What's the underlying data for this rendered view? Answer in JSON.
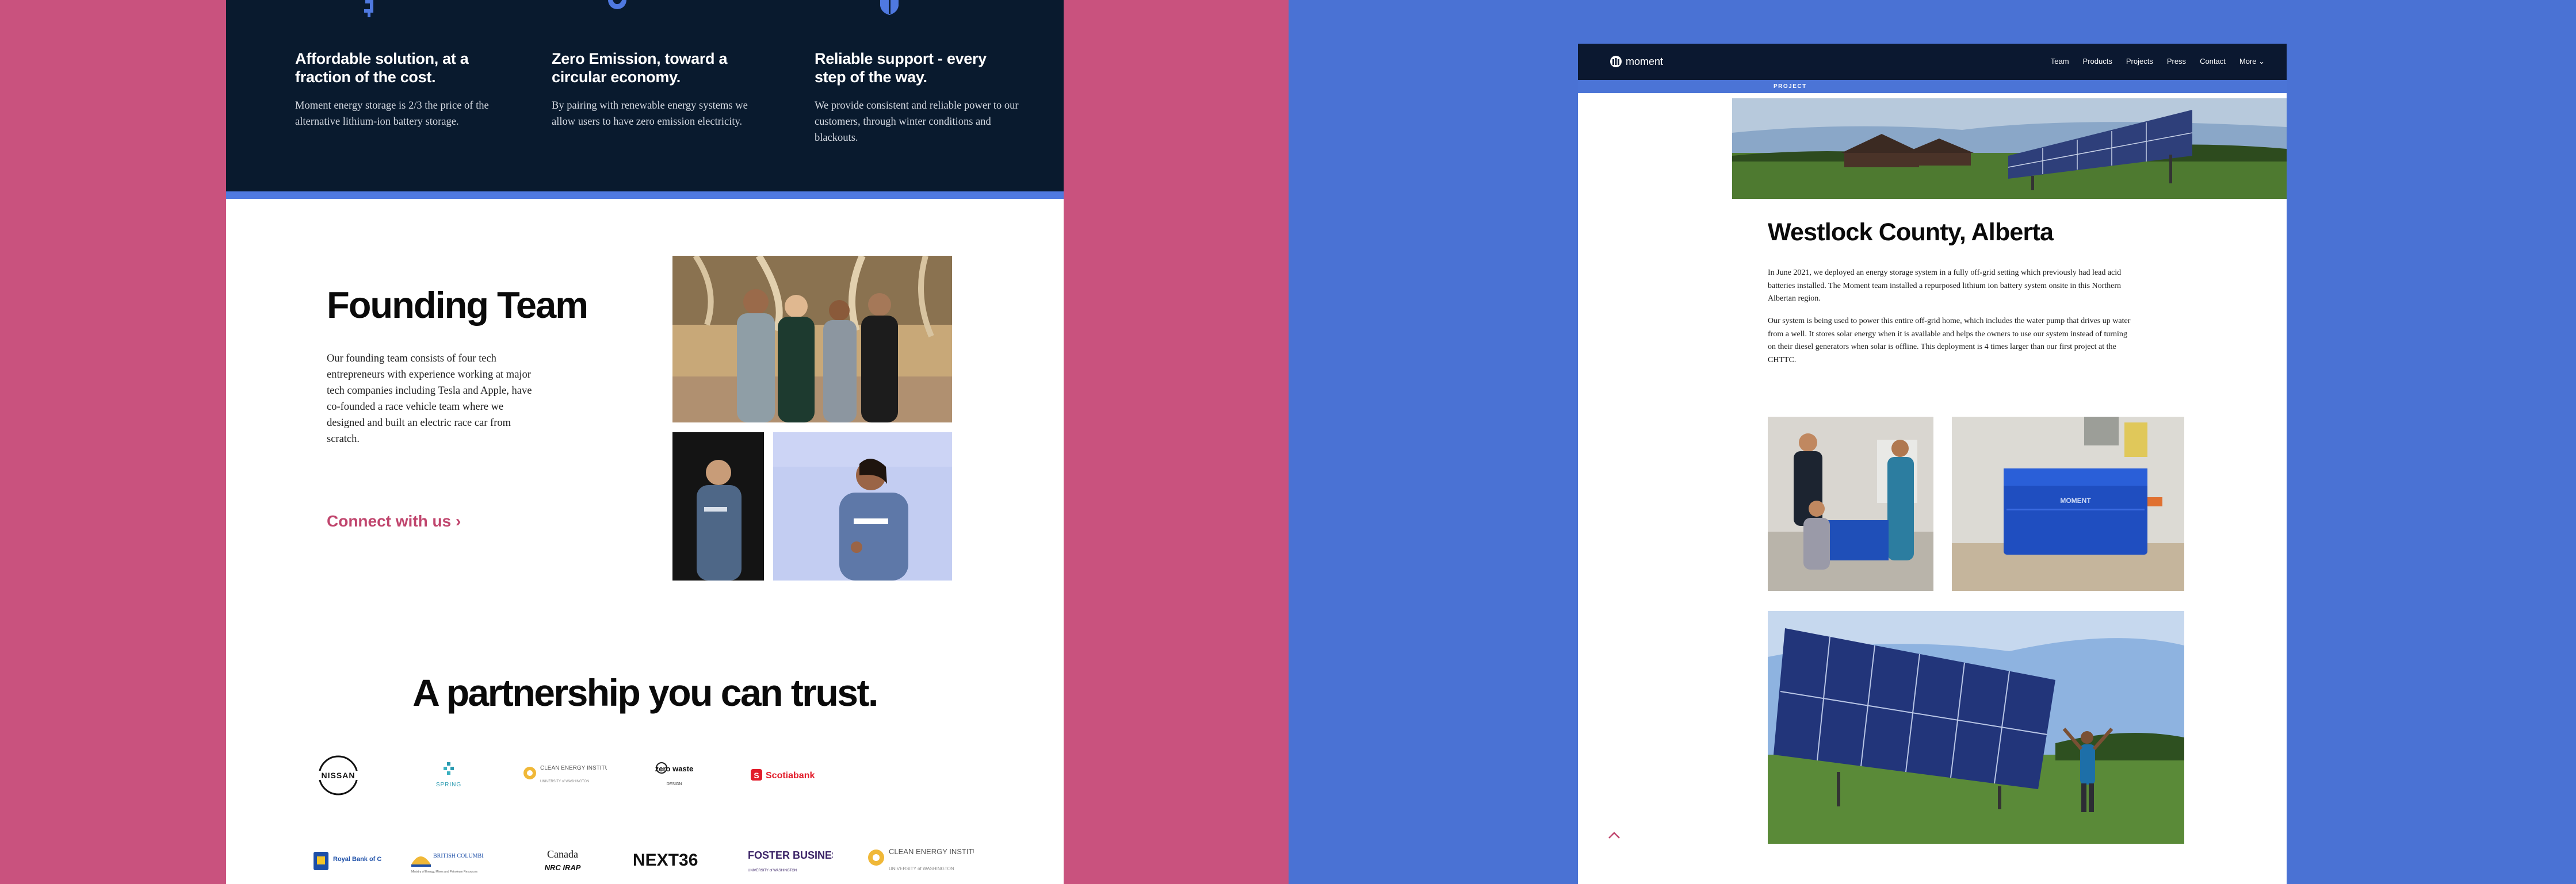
{
  "left": {
    "features": [
      {
        "icon": "dollar-icon",
        "title": "Affordable solution, at a fraction of the cost.",
        "body": "Moment energy storage is 2/3 the price of the alternative lithium-ion battery storage."
      },
      {
        "icon": "globe-icon",
        "title": "Zero Emission, toward a circular economy.",
        "body": "By pairing with renewable energy systems we allow users to have zero emission electricity."
      },
      {
        "icon": "shield-icon",
        "title": "Reliable support - every step of the way.",
        "body": "We provide consistent and reliable power to our customers, through winter conditions and blackouts."
      }
    ],
    "founding": {
      "title": "Founding Team",
      "body": "Our founding team consists of four tech entrepreneurs with experience working at major tech companies including Tesla and Apple, have co-founded a race vehicle team where we designed and built an electric race car from scratch.",
      "link": "Connect with us ›"
    },
    "partners": {
      "title": "A partnership you can trust.",
      "logos": [
        {
          "name": "NISSAN"
        },
        {
          "name": "SPRING"
        },
        {
          "name": "CLEAN ENERGY INSTITUTE",
          "sub": "UNIVERSITY of WASHINGTON"
        },
        {
          "name": "zero waste",
          "sub": "DESIGN"
        },
        {
          "name": "Scotiabank"
        },
        {
          "name": "Royal Bank of Canada"
        },
        {
          "name": "BRITISH COLUMBIA",
          "sub": "Ministry of Energy, Mines and Petroleum Resources"
        },
        {
          "name": "Canada",
          "sub": "NRC IRAP"
        },
        {
          "name": "NEXT36"
        },
        {
          "name": "FOSTER BUSINESS",
          "sub": "UNIVERSITY of WASHINGTON"
        },
        {
          "name": "CLEAN ENERGY INSTITUTE",
          "sub": "UNIVERSITY of WASHINGTON"
        }
      ]
    }
  },
  "right": {
    "brand": "moment",
    "nav": [
      "Team",
      "Products",
      "Projects",
      "Press",
      "Contact",
      "More ⌄"
    ],
    "tag": "PROJECT",
    "title": "Westlock County, Alberta",
    "paragraphs": [
      "In June 2021, we deployed an energy storage system in a fully off-grid setting which previously had lead acid batteries installed. The Moment team installed a repurposed lithium ion battery system onsite in this Northern Albertan region.",
      "Our system is being used to power this entire off-grid home, which includes the water pump that drives up water from a well. It stores solar energy when it is available and helps the owners to use our system instead of turning on their diesel generators when solar is offline. This deployment is 4 times larger than our first project at the CHTTC."
    ],
    "colors": {
      "accent": "#4b74d6",
      "nav": "#0b1830"
    }
  }
}
